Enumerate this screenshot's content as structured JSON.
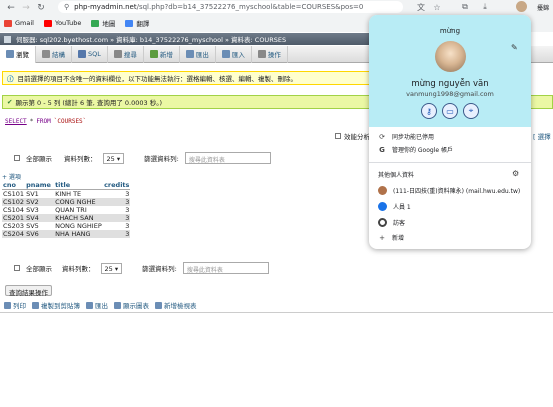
{
  "browser": {
    "url_host": "php-myadmin.net",
    "url_path": "/sql.php?db=b14_37522276_myschool&table=COURSES&pos=0",
    "bookmarks": [
      {
        "label": "Gmail",
        "color": "#ea4335"
      },
      {
        "label": "YouTube",
        "color": "#ff0000"
      },
      {
        "label": "地圖",
        "color": "#34a853"
      },
      {
        "label": "翻譯",
        "color": "#4285f4"
      }
    ],
    "profile_label": "擾錦"
  },
  "pma": {
    "breadcrumb": "伺服器: sql202.byethost.com » 資料庫: b14_37522276_myschool » 資料表: COURSES",
    "tabs": [
      {
        "label": "瀏覽",
        "color": "#6b8db5"
      },
      {
        "label": "結構",
        "color": "#8c8c8c"
      },
      {
        "label": "SQL",
        "color": "#5577aa"
      },
      {
        "label": "搜尋",
        "color": "#888888"
      },
      {
        "label": "新增",
        "color": "#5d9c3e"
      },
      {
        "label": "匯出",
        "color": "#6b8db5"
      },
      {
        "label": "匯入",
        "color": "#6b8db5"
      },
      {
        "label": "操作",
        "color": "#888888"
      }
    ],
    "notice": "目前選擇的項目不含唯一的資料欄位，以下功能無法執行：選格編輯、核選、編輯、複製、刪除。",
    "success": "顯示第 0 - 5 列 (總計 6 筆, 查詢用了 0.0003 秒。)",
    "sql_select": "SELECT",
    "sql_star": "*",
    "sql_from": "FROM",
    "sql_table": "`COURSES`",
    "profiling_label": "效能分析",
    "profiling_right": "[ 選擇",
    "show_all": "全部顯示",
    "rows_label": "資料列數：",
    "rows_value": "25",
    "filter_label": "篩選資料列:",
    "filter_placeholder": "搜尋此資料表",
    "options_link": "+ 選項",
    "columns": [
      "cno",
      "pname",
      "title",
      "credits"
    ],
    "rows": [
      [
        "CS101",
        "SV1",
        "KINH TE",
        "3"
      ],
      [
        "CS102",
        "SV2",
        "CONG NGHE",
        "3"
      ],
      [
        "CS104",
        "SV3",
        "QUAN TRI",
        "3"
      ],
      [
        "CS201",
        "SV4",
        "KHACH SAN",
        "3"
      ],
      [
        "CS203",
        "SV5",
        "NONG NGHIEP",
        "3"
      ],
      [
        "CS204",
        "SV6",
        "NHA HANG",
        "3"
      ]
    ],
    "query_ops": "查詢結果操作",
    "query_links": [
      "列印",
      "複製到剪貼簿",
      "匯出",
      "顯示圖表",
      "新增檢視表"
    ]
  },
  "popup": {
    "top_label": "mừng",
    "name": "mừng nguyễn văn",
    "email": "vanmung1998@gmail.com",
    "menu": [
      {
        "icon": "sync-icon",
        "glyph": "⟳",
        "label": "同步功能已停用"
      },
      {
        "icon": "google-icon",
        "glyph": "G",
        "label": "管理你的 Google 帳戶"
      }
    ],
    "other_header": "其他個人資料",
    "accounts": [
      {
        "label": "(111-日四技(重)資料陳永) (mail.hwu.edu.tw)",
        "color": "#b0724a"
      },
      {
        "label": "人員 1",
        "color": "#1a73e8"
      },
      {
        "label": "訪客",
        "color": "#444444"
      },
      {
        "label": "新增",
        "color": "#444444"
      }
    ]
  }
}
